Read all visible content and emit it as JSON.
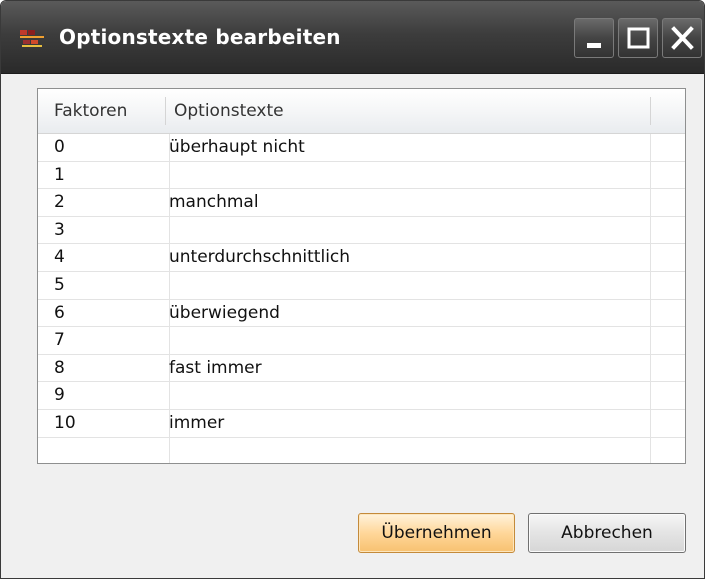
{
  "window": {
    "title": "Optionstexte bearbeiten"
  },
  "grid": {
    "columns": [
      "Faktoren",
      "Optionstexte"
    ],
    "rows": [
      {
        "faktor": "0",
        "text": "überhaupt nicht"
      },
      {
        "faktor": "1",
        "text": ""
      },
      {
        "faktor": "2",
        "text": "manchmal"
      },
      {
        "faktor": "3",
        "text": ""
      },
      {
        "faktor": "4",
        "text": "unterdurchschnittlich"
      },
      {
        "faktor": "5",
        "text": ""
      },
      {
        "faktor": "6",
        "text": "überwiegend"
      },
      {
        "faktor": "7",
        "text": ""
      },
      {
        "faktor": "8",
        "text": "fast immer"
      },
      {
        "faktor": "9",
        "text": ""
      },
      {
        "faktor": "10",
        "text": "immer"
      },
      {
        "faktor": "",
        "text": ""
      }
    ]
  },
  "buttons": {
    "ok_label": "Übernehmen",
    "cancel_label": "Abbrechen"
  },
  "icons": {
    "app": "app-icon",
    "minimize": "minimize-icon",
    "maximize": "maximize-icon",
    "close": "close-icon"
  },
  "colors": {
    "titlebar": "#3d3d3d",
    "ok_button": "#ffd79a"
  }
}
